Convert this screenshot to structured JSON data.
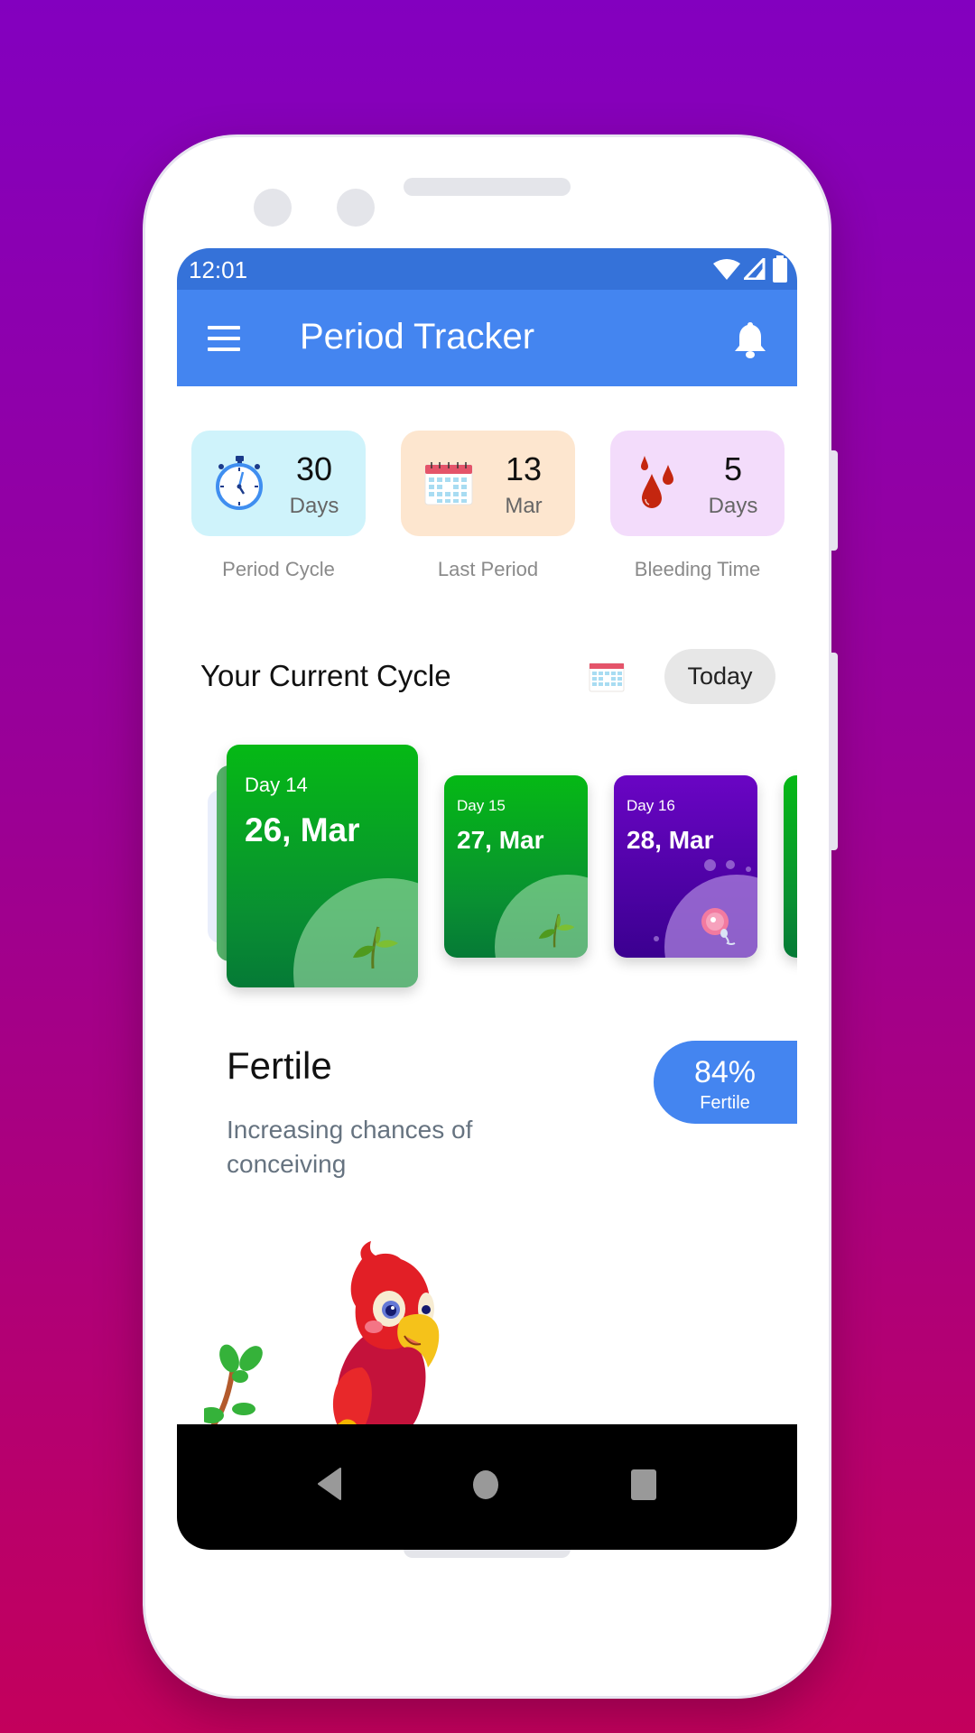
{
  "status_bar": {
    "time": "12:01"
  },
  "app_bar": {
    "title": "Period Tracker",
    "menu_icon": "hamburger-menu-icon",
    "notification_icon": "bell-icon"
  },
  "stats": [
    {
      "value": "30",
      "unit": "Days",
      "label": "Period Cycle",
      "icon": "stopwatch-icon",
      "bg": "#cff3fb"
    },
    {
      "value": "13",
      "unit": "Mar",
      "label": "Last Period",
      "icon": "calendar-icon",
      "bg": "#fde6cf"
    },
    {
      "value": "5",
      "unit": "Days",
      "label": "Bleeding Time",
      "icon": "blood-drops-icon",
      "bg": "#f3dcfb"
    }
  ],
  "cycle": {
    "title": "Your Current Cycle",
    "today_label": "Today",
    "days": [
      {
        "day": "Day 14",
        "date": "26, Mar",
        "phase": "fertile",
        "selected": true
      },
      {
        "day": "Day 15",
        "date": "27, Mar",
        "phase": "fertile",
        "selected": false
      },
      {
        "day": "Day 16",
        "date": "28, Mar",
        "phase": "ovulation",
        "selected": false
      }
    ]
  },
  "status": {
    "title": "Fertile",
    "description": "Increasing chances of conceiving",
    "percent": "84%",
    "percent_label": "Fertile"
  },
  "colors": {
    "primary": "#4485f0",
    "status_bar": "#3572d9",
    "fertile_green": "#05b915",
    "ovulation_purple": "#6a05c4"
  }
}
